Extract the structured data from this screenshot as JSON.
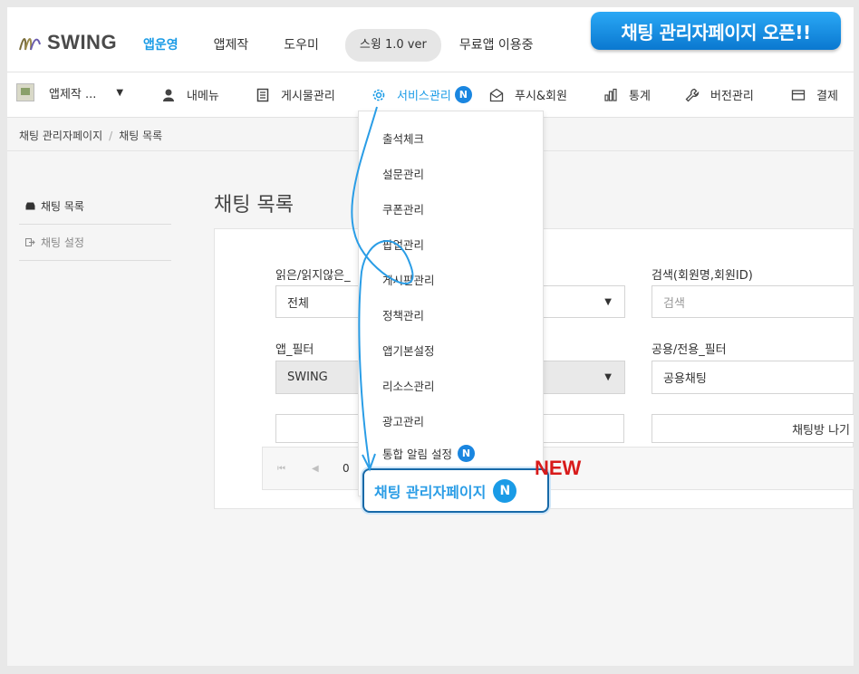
{
  "brand": {
    "name": "SWING"
  },
  "banner": "채팅 관리자페이지 오픈!!",
  "top_nav": [
    {
      "label": "앱운영"
    },
    {
      "label": "앱제작"
    },
    {
      "label": "도우미"
    }
  ],
  "version": "스윙 1.0 ver",
  "free_app": "무료앱 이용중",
  "app_selector": {
    "name": "앱제작 ..."
  },
  "menu": [
    {
      "label": "내메뉴",
      "icon": "person-icon"
    },
    {
      "label": "게시물관리",
      "icon": "document-icon"
    },
    {
      "label": "서비스관리",
      "icon": "gear-icon",
      "badge": "N"
    },
    {
      "label": "푸시&회원",
      "icon": "envelope-icon"
    },
    {
      "label": "통계",
      "icon": "bar-chart-icon"
    },
    {
      "label": "버전관리",
      "icon": "wrench-icon"
    },
    {
      "label": "결제",
      "icon": "card-icon"
    }
  ],
  "breadcrumb": [
    "채팅 관리자페이지",
    "채팅 목록"
  ],
  "side_menu": [
    {
      "label": "채팅 목록"
    },
    {
      "label": "채팅 설정"
    }
  ],
  "page_title": "채팅 목록",
  "filters": {
    "read_label": "읽은/읽지않은_",
    "read_value": "전체",
    "search_label": "검색(회원명,회원ID)",
    "search_placeholder": "검색",
    "app_label": "앱_필터",
    "app_value": "SWING",
    "share_label": "공용/전용_필터",
    "share_value": "공용채팅",
    "exit_button": "채팅방 나기"
  },
  "pager": {
    "first": "⏮",
    "prev": "◀",
    "current": "0"
  },
  "dropdown": [
    {
      "label": "출석체크"
    },
    {
      "label": "설문관리"
    },
    {
      "label": "쿠폰관리"
    },
    {
      "label": "팝업관리"
    },
    {
      "label": "게시판관리"
    },
    {
      "label": "정책관리"
    },
    {
      "label": "앱기본설정"
    },
    {
      "label": "리소스관리"
    },
    {
      "label": "광고관리"
    },
    {
      "label": "통합 알림 설정",
      "badge": "N"
    }
  ],
  "highlight": {
    "label": "채팅 관리자페이지",
    "badge": "N"
  },
  "new_tag": "NEW",
  "colors": {
    "accent": "#1a9be6",
    "badge": "#1a86e0",
    "new": "#d81b1b",
    "highlight_border": "#1769a8"
  }
}
